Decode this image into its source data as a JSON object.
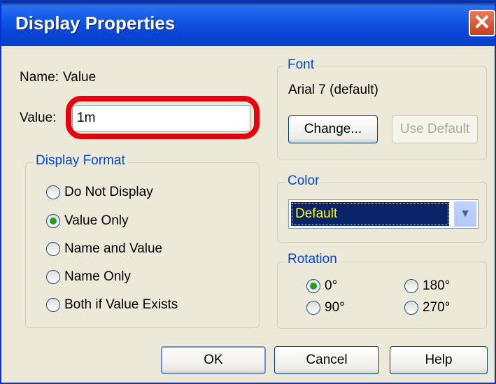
{
  "window": {
    "title": "Display Properties",
    "close_glyph": "✕"
  },
  "name_row": {
    "label": "Name:",
    "value": "Value"
  },
  "value_row": {
    "label": "Value:",
    "input_value": "1m"
  },
  "display_format": {
    "legend": "Display Format",
    "options": [
      {
        "label": "Do Not Display",
        "selected": false
      },
      {
        "label": "Value Only",
        "selected": true
      },
      {
        "label": "Name and Value",
        "selected": false
      },
      {
        "label": "Name Only",
        "selected": false
      },
      {
        "label": "Both if Value Exists",
        "selected": false
      }
    ]
  },
  "font": {
    "legend": "Font",
    "current": "Arial 7 (default)",
    "change_button": "Change...",
    "use_default_button": "Use Default"
  },
  "color": {
    "legend": "Color",
    "selected": "Default",
    "selected_bg": "#0a246a",
    "selected_fg": "#ffff00"
  },
  "rotation": {
    "legend": "Rotation",
    "options": [
      {
        "label": "0°",
        "selected": true
      },
      {
        "label": "180°",
        "selected": false
      },
      {
        "label": "90°",
        "selected": false
      },
      {
        "label": "270°",
        "selected": false
      }
    ]
  },
  "buttons": {
    "ok": "OK",
    "cancel": "Cancel",
    "help": "Help"
  },
  "colors": {
    "title_bar": "#0a45d6",
    "highlight": "#e8000c",
    "legend_text": "#0046d5",
    "radio_dot": "#21a121"
  }
}
